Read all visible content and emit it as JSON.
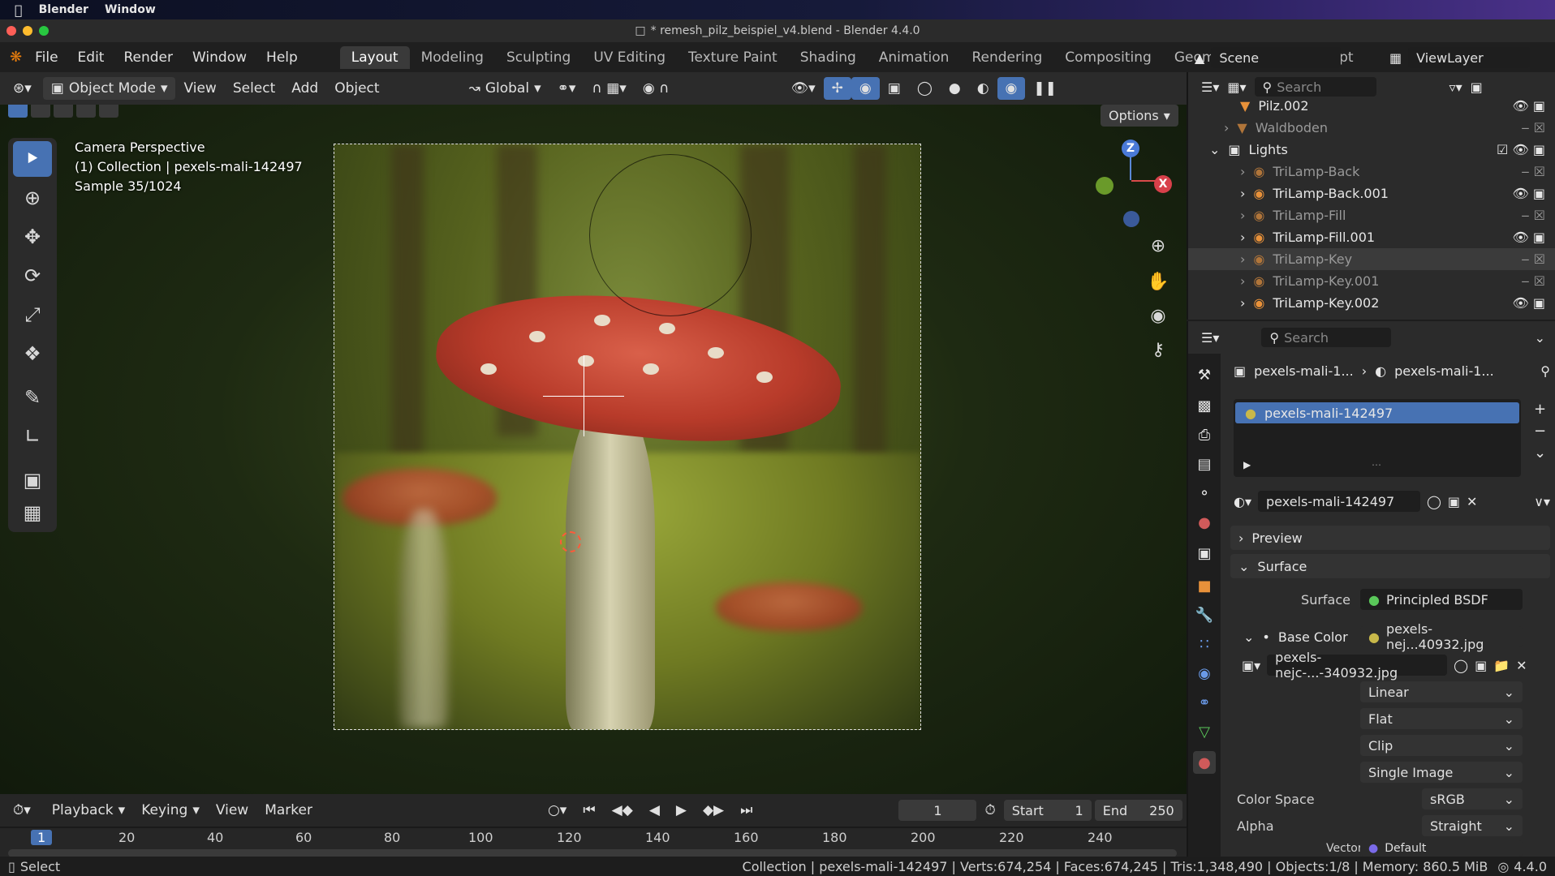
{
  "macbar": {
    "app": "Blender",
    "window": "Window"
  },
  "title": "* remesh_pilz_beispiel_v4.blend - Blender 4.4.0",
  "menu": [
    "File",
    "Edit",
    "Render",
    "Window",
    "Help"
  ],
  "workspaces": [
    "Layout",
    "Modeling",
    "Sculpting",
    "UV Editing",
    "Texture Paint",
    "Shading",
    "Animation",
    "Rendering",
    "Compositing",
    "Geometry Nodes",
    "Script"
  ],
  "scene": "Scene",
  "viewlayer": "ViewLayer",
  "viewport": {
    "mode": "Object Mode",
    "view": "View",
    "select": "Select",
    "add": "Add",
    "object": "Object",
    "transform": "Global",
    "options": "Options",
    "overlay": [
      "Camera Perspective",
      "(1) Collection | pexels-mali-142497",
      "Sample 35/1024"
    ]
  },
  "gizmo": {
    "z": "Z",
    "x": "X"
  },
  "outliner": {
    "search": "Search",
    "rows": [
      "Pilz.002",
      "Waldboden",
      "Lights",
      "TriLamp-Back",
      "TriLamp-Back.001",
      "TriLamp-Fill",
      "TriLamp-Fill.001",
      "TriLamp-Key",
      "TriLamp-Key.001",
      "TriLamp-Key.002"
    ]
  },
  "props": {
    "search": "Search",
    "crumb1": "pexels-mali-1...",
    "crumb2": "pexels-mali-1...",
    "slot": "pexels-mali-142497",
    "material": "pexels-mali-142497",
    "preview": "Preview",
    "surface_section": "Surface",
    "surface_label": "Surface",
    "surface_value": "Principled BSDF",
    "base_color_label": "Base Color",
    "base_color_value": "pexels-nej...40932.jpg",
    "image": "pexels-nejc-...-340932.jpg",
    "interp": "Linear",
    "proj": "Flat",
    "ext": "Clip",
    "source": "Single Image",
    "colorspace_label": "Color Space",
    "colorspace": "sRGB",
    "alpha_label": "Alpha",
    "alpha": "Straight",
    "vector_label": "Vector",
    "vector": "Default"
  },
  "timeline": {
    "playback": "Playback",
    "keying": "Keying",
    "view": "View",
    "marker": "Marker",
    "frame": "1",
    "start_label": "Start",
    "start": "1",
    "end_label": "End",
    "end": "250",
    "ticks": [
      "1",
      "20",
      "40",
      "60",
      "80",
      "100",
      "120",
      "140",
      "160",
      "180",
      "200",
      "220",
      "240"
    ]
  },
  "status": {
    "left": "Select",
    "info": "Collection | pexels-mali-142497 | Verts:674,254 | Faces:674,245 | Tris:1,348,490 | Objects:1/8 | Memory: 860.5 MiB",
    "version": "4.4.0"
  }
}
